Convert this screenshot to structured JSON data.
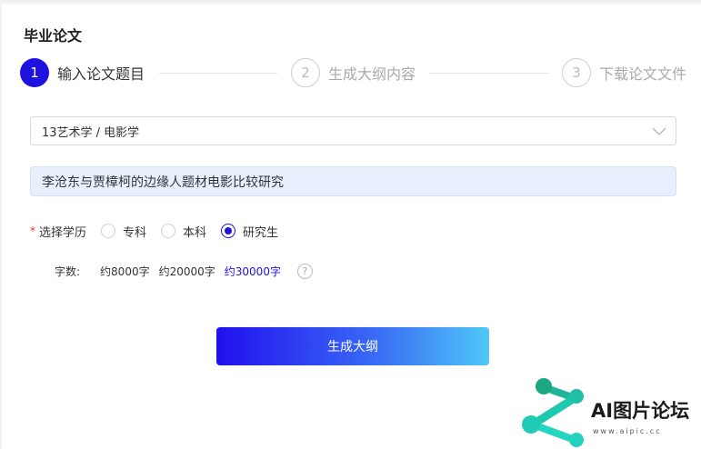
{
  "page": {
    "title": "毕业论文"
  },
  "steps": [
    {
      "num": "1",
      "label": "输入论文题目",
      "state": "active"
    },
    {
      "num": "2",
      "label": "生成大纲内容",
      "state": "inactive"
    },
    {
      "num": "3",
      "label": "下载论文文件",
      "state": "inactive"
    }
  ],
  "subject_select": {
    "value": "13艺术学 / 电影学"
  },
  "topic_input": {
    "value": "李沧东与贾樟柯的边缘人题材电影比较研究"
  },
  "education": {
    "required_mark": "*",
    "label": "选择学历",
    "options": [
      "专科",
      "本科",
      "研究生"
    ],
    "selected": "研究生"
  },
  "word_count": {
    "label": "字数:",
    "options": [
      "约8000字",
      "约20000字",
      "约30000字"
    ],
    "selected": "约30000字",
    "help_symbol": "?"
  },
  "generate_button": {
    "label": "生成大纲"
  },
  "watermark": {
    "text": "AI图片论坛",
    "url": "www.aipic.cc"
  },
  "colors": {
    "accent": "#1f12e0",
    "gradient_end": "#4fc8f8",
    "topic_bg": "#e8f0fe"
  }
}
